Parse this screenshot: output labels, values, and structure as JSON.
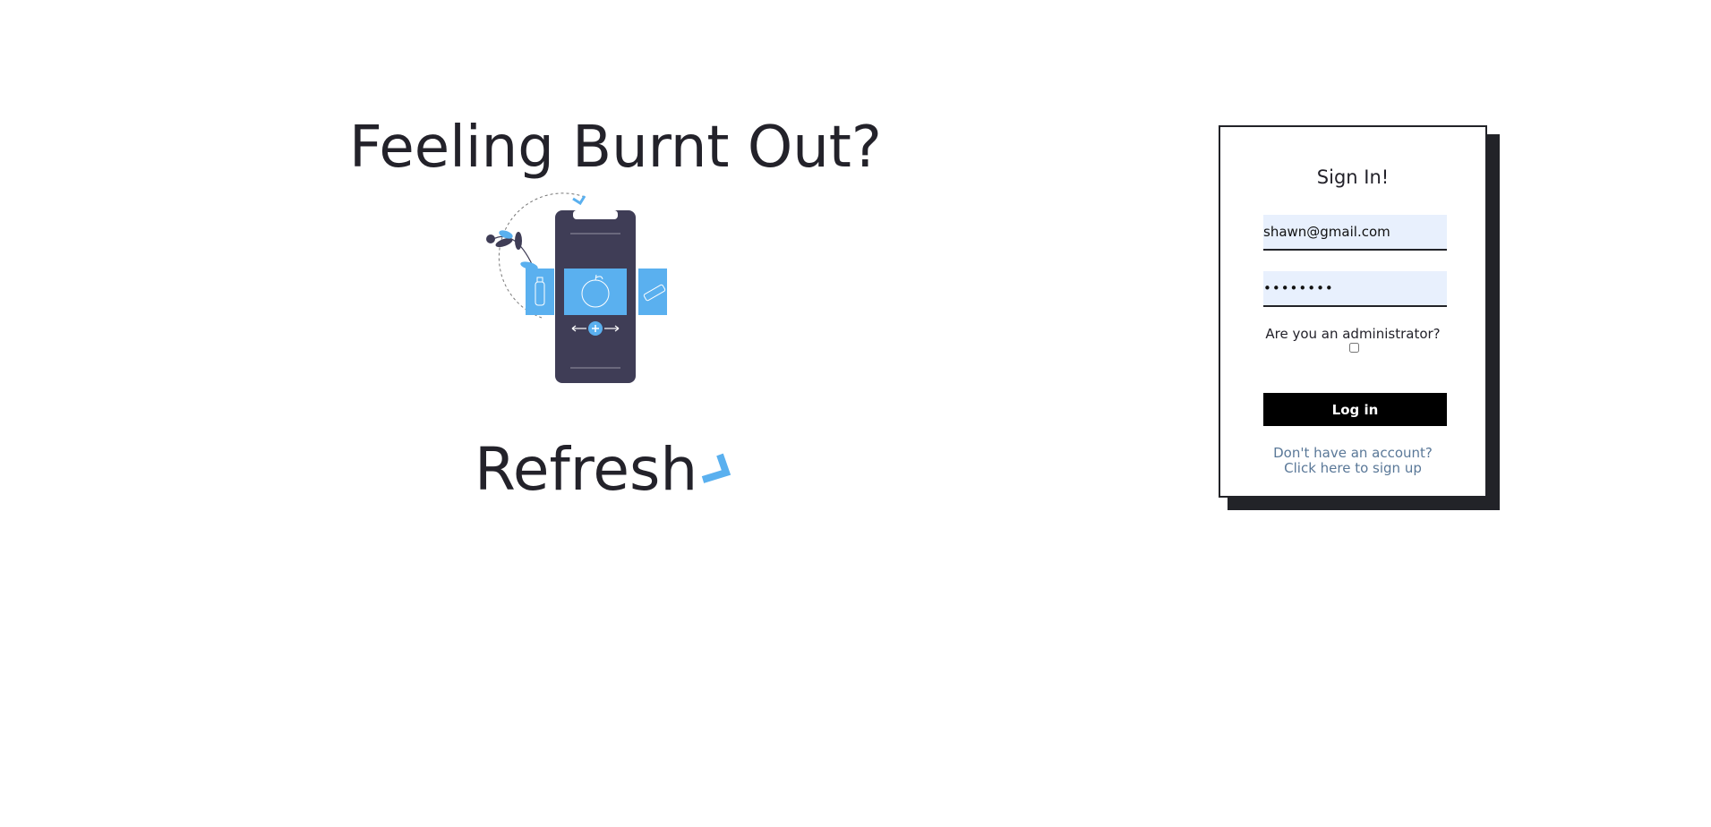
{
  "hero": {
    "title": "Feeling Burnt Out?",
    "brand_name": "Refresh",
    "illustration_icon": "phone-food-illustration",
    "brand_mark_icon": "check-mark-icon"
  },
  "signin": {
    "title": "Sign In!",
    "email_value": "shawn@gmail.com",
    "password_value": "••••••••",
    "admin_label": "Are you an administrator?",
    "admin_checked": false,
    "login_label": "Log in",
    "signup_line1": "Don't have an account?",
    "signup_line2": "Click here to sign up"
  },
  "colors": {
    "accent_blue": "#5ab0ef",
    "dark": "#3f3d56",
    "field_bg": "#e8f0fd",
    "link": "#5a7898"
  }
}
